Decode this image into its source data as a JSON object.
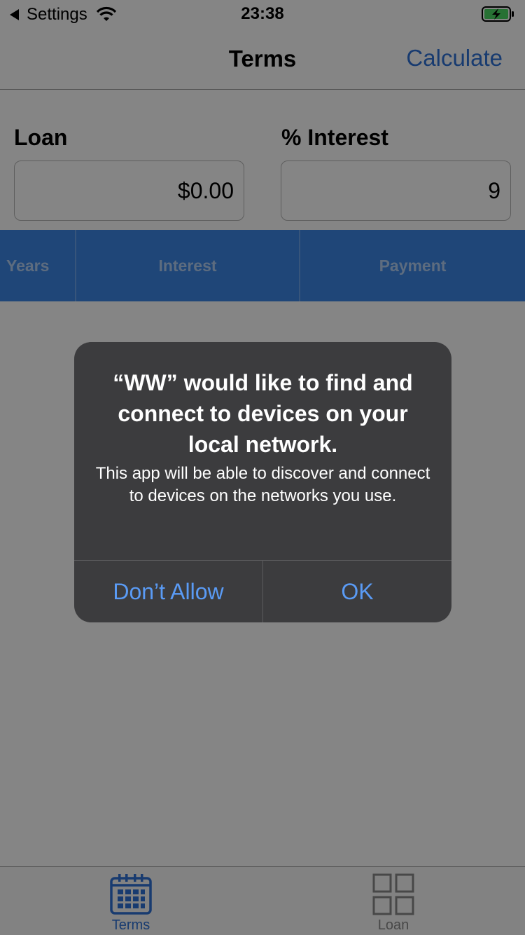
{
  "status_bar": {
    "back_label": "Settings",
    "time": "23:38"
  },
  "nav": {
    "title": "Terms",
    "action": "Calculate"
  },
  "form": {
    "loan_label": "Loan",
    "loan_value": "$0.00",
    "interest_label": "% Interest",
    "interest_value": "9"
  },
  "table": {
    "columns": [
      "Years",
      "Interest",
      "Payment"
    ]
  },
  "tabs": [
    {
      "label": "Terms",
      "icon": "calendar-icon"
    },
    {
      "label": "Loan",
      "icon": "grid-icon"
    }
  ],
  "alert": {
    "title": "“WW” would like to find and connect to devices on your local network.",
    "message": "This app will be able to discover and connect to devices on the networks you use.",
    "deny_label": "Don’t Allow",
    "ok_label": "OK"
  },
  "colors": {
    "accent": "#2f72d6",
    "table_header": "#3d87e6",
    "alert_background": "#3c3c3e",
    "alert_button": "#5a9bf5",
    "battery_charging": "#4cd964"
  }
}
